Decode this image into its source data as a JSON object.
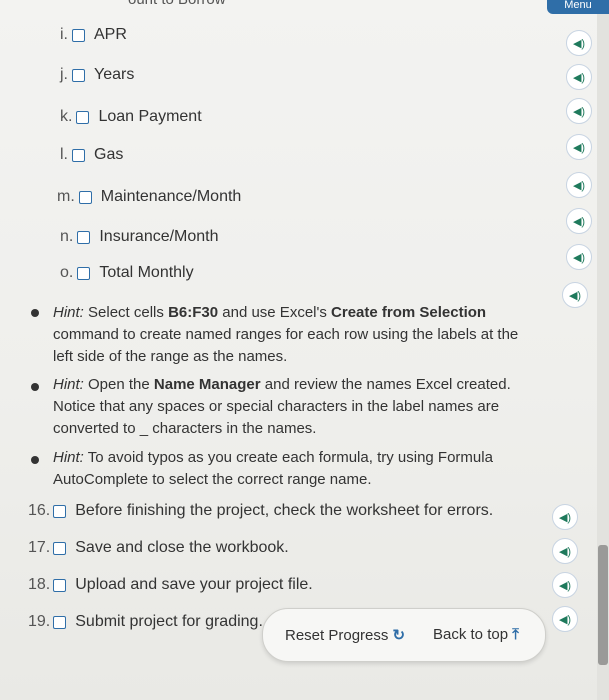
{
  "top": {
    "partial_text": "ount to Borrow",
    "menu_label": "Menu"
  },
  "checklist": [
    {
      "marker": "i.",
      "label": "APR"
    },
    {
      "marker": "j.",
      "label": "Years"
    },
    {
      "marker": "k.",
      "label": "Loan Payment"
    },
    {
      "marker": "l.",
      "label": "Gas"
    },
    {
      "marker": "m.",
      "label": "Maintenance/Month"
    },
    {
      "marker": "n.",
      "label": "Insurance/Month"
    },
    {
      "marker": "o.",
      "label": "Total Monthly"
    }
  ],
  "hints": [
    {
      "prefix": "Hint:",
      "t1": "Select cells",
      "b1": "B6:F30",
      "t2": "and use Excel's",
      "b2": "Create from Selection",
      "t3": "command to create named ranges for each row using the labels at the left side of the range as the names."
    },
    {
      "prefix": "Hint:",
      "t1": "Open the",
      "b1": "Name Manager",
      "t2": "and review the names Excel created. Notice that any spaces or special characters in the label names are converted to _ characters in the names."
    },
    {
      "prefix": "Hint:",
      "t1": "To avoid typos as you create each formula, try using Formula AutoComplete to select the correct range name."
    }
  ],
  "steps": [
    {
      "num": "16.",
      "label": "Before finishing the project, check the worksheet for errors."
    },
    {
      "num": "17.",
      "label": "Save and close the workbook."
    },
    {
      "num": "18.",
      "label": "Upload and save your project file."
    },
    {
      "num": "19.",
      "label": "Submit project for grading."
    }
  ],
  "footer": {
    "reset_label": "Reset Progress",
    "back_label": "Back to top"
  },
  "audio_icon_glyph": "◀)",
  "colors": {
    "accent": "#2f6ea8",
    "audio": "#1f7a5c"
  }
}
